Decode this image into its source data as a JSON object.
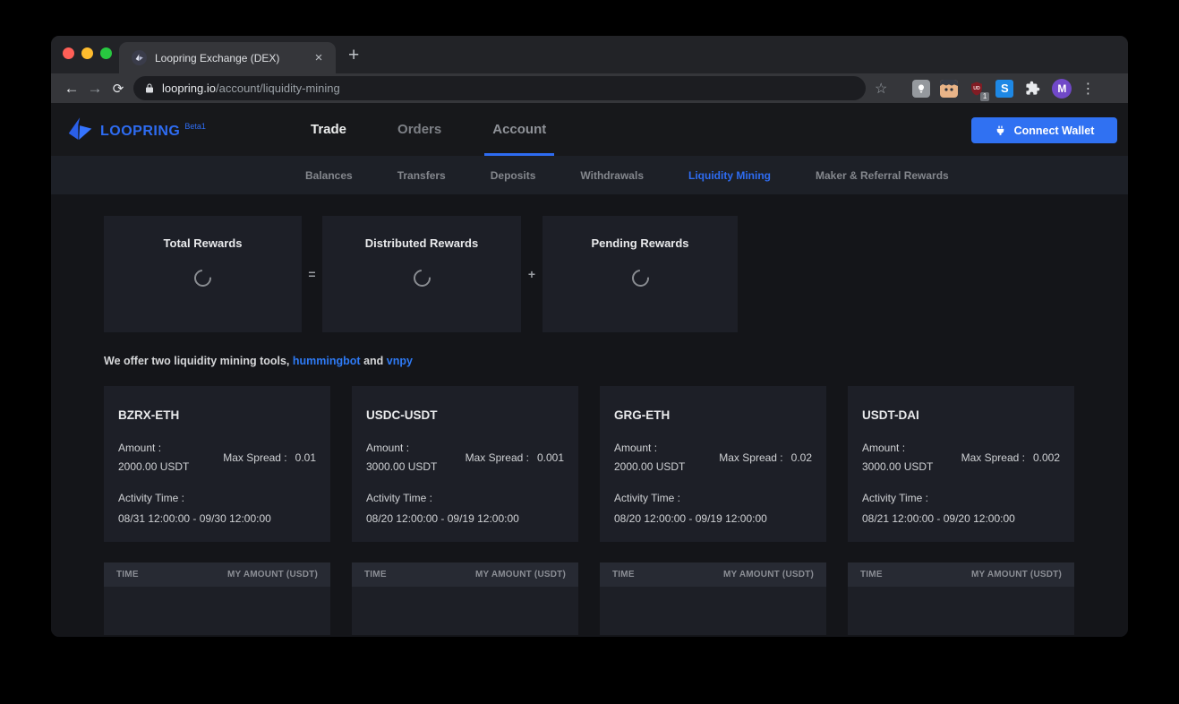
{
  "browser": {
    "tab": {
      "title": "Loopring Exchange (DEX)",
      "close_glyph": "×",
      "new_tab_glyph": "+"
    },
    "nav": {
      "back_glyph": "←",
      "forward_glyph": "→",
      "reload_glyph": "⟳",
      "star_glyph": "☆",
      "kebab_glyph": "⋮"
    },
    "url": {
      "domain": "loopring.io",
      "path": "/account/liquidity-mining"
    },
    "extensions": {
      "ublock_badge": "1",
      "s_label": "S"
    },
    "profile_initial": "M"
  },
  "header": {
    "logo_text": "LOOPRING",
    "beta_label": "Beta1",
    "nav": [
      {
        "label": "Trade"
      },
      {
        "label": "Orders"
      },
      {
        "label": "Account"
      }
    ],
    "connect_wallet": {
      "label": "Connect Wallet"
    }
  },
  "subnav": {
    "items": [
      {
        "label": "Balances"
      },
      {
        "label": "Transfers"
      },
      {
        "label": "Deposits"
      },
      {
        "label": "Withdrawals"
      },
      {
        "label": "Liquidity Mining"
      },
      {
        "label": "Maker & Referral Rewards"
      }
    ]
  },
  "rewards": {
    "cards": [
      {
        "title": "Total Rewards"
      },
      {
        "title": "Distributed Rewards"
      },
      {
        "title": "Pending Rewards"
      }
    ],
    "equals": "=",
    "plus": "+"
  },
  "intro": {
    "text_prefix": "We offer two liquidity mining tools,",
    "link_hummingbot": "hummingbot",
    "text_and": "and",
    "link_vnpy": "vnpy"
  },
  "mining": {
    "labels": {
      "amount": "Amount :",
      "max_spread": "Max Spread :",
      "activity": "Activity Time :"
    },
    "pairs": [
      {
        "name": "BZRX-ETH",
        "amount": "2000.00 USDT",
        "max_spread": "0.01",
        "activity_time": "08/31 12:00:00 - 09/30 12:00:00"
      },
      {
        "name": "USDC-USDT",
        "amount": "3000.00 USDT",
        "max_spread": "0.001",
        "activity_time": "08/20 12:00:00 - 09/19 12:00:00"
      },
      {
        "name": "GRG-ETH",
        "amount": "2000.00 USDT",
        "max_spread": "0.02",
        "activity_time": "08/20 12:00:00 - 09/19 12:00:00"
      },
      {
        "name": "USDT-DAI",
        "amount": "3000.00 USDT",
        "max_spread": "0.002",
        "activity_time": "08/21 12:00:00 - 09/20 12:00:00"
      }
    ],
    "table": {
      "time_header": "TIME",
      "amount_header": "MY AMOUNT (USDT)"
    }
  },
  "colors": {
    "accent_blue": "#2e6cf2",
    "card_bg": "#1d1f27",
    "page_bg": "#141519",
    "button_blue": "#3071f2"
  }
}
